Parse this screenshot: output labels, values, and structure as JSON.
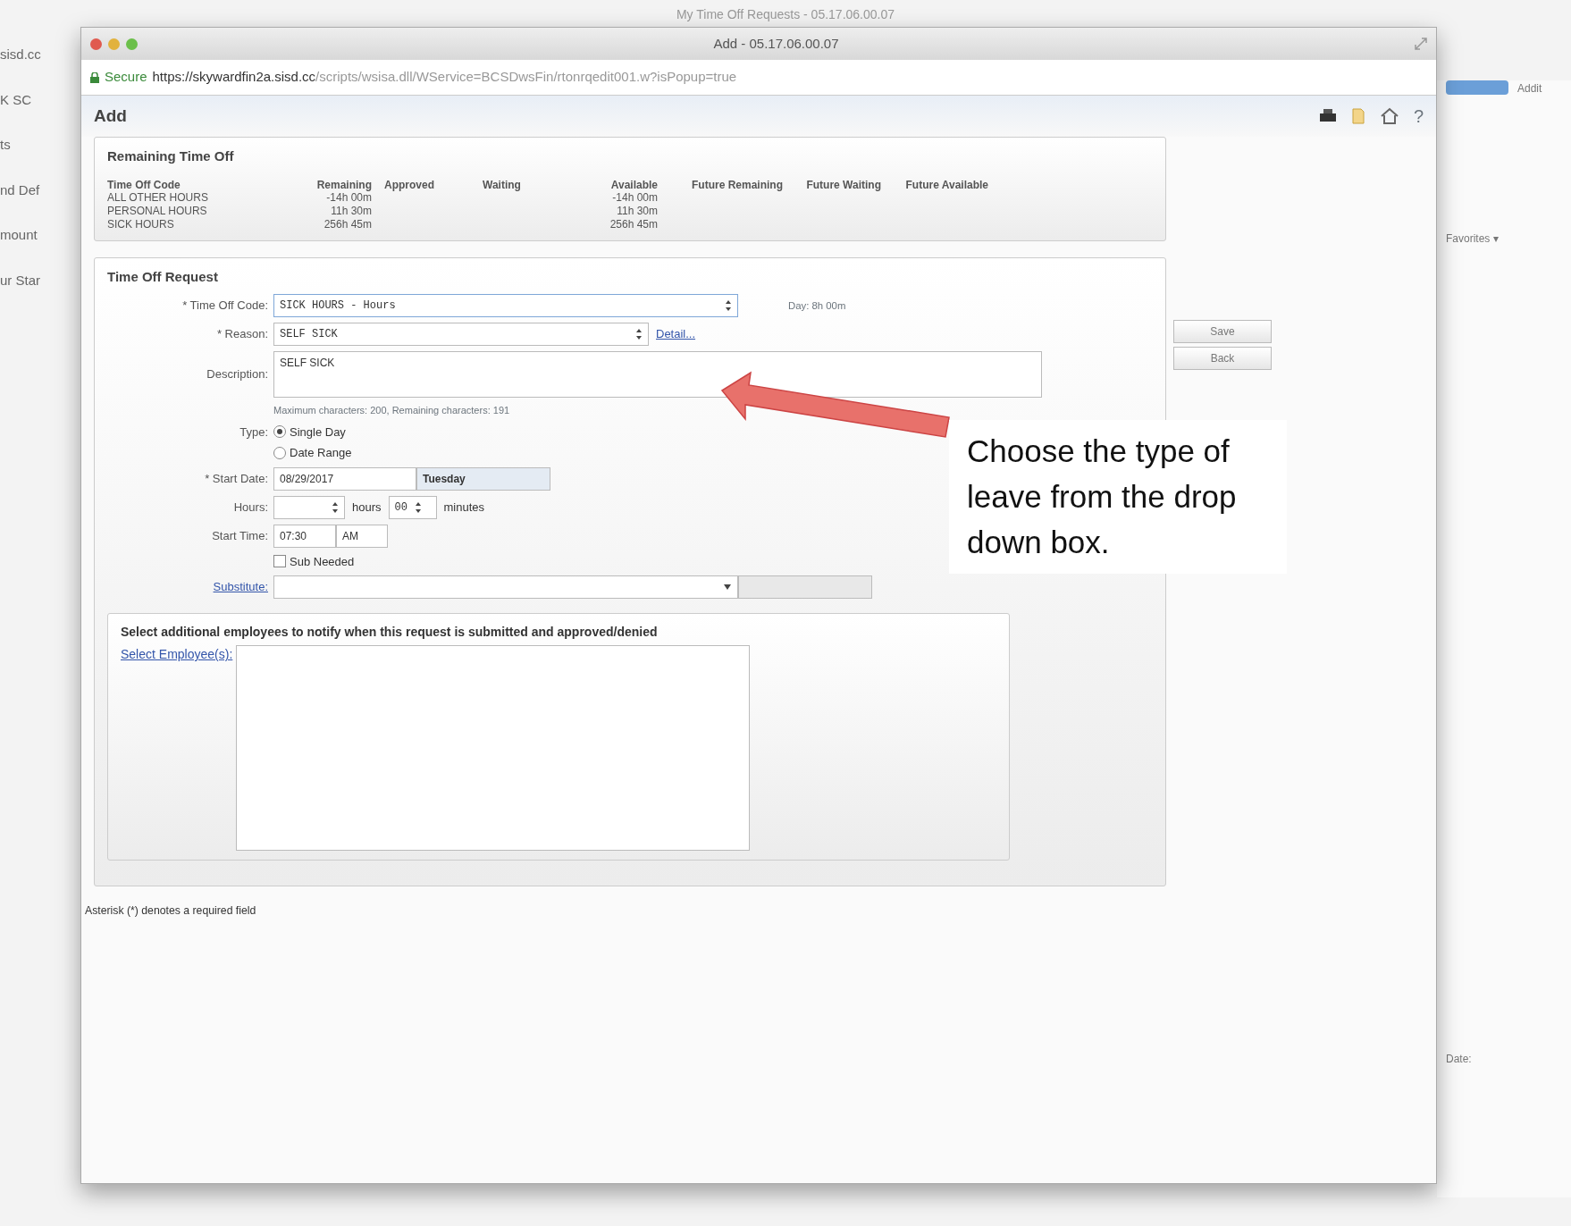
{
  "background_page": {
    "title": "My Time Off Requests - 05.17.06.00.07",
    "left_texts": [
      "sisd.cc",
      "K SC",
      "ts",
      "nd Def",
      "mount",
      "ur Star"
    ],
    "right_texts": [
      "Addit",
      "Favorites ▾",
      "Date:"
    ]
  },
  "window": {
    "title": "Add - 05.17.06.00.07",
    "secure": "Secure",
    "url_host": "https://skywardfin2a.sisd.cc",
    "url_path": "/scripts/wsisa.dll/WService=BCSDwsFin/rtonrqedit001.w?isPopup=true"
  },
  "page_title": "Add",
  "help": "?",
  "remaining": {
    "title": "Remaining Time Off",
    "columns": [
      "Time Off Code",
      "Remaining",
      "Approved",
      "Waiting",
      "Available",
      "Future Remaining",
      "Future Waiting",
      "Future Available"
    ],
    "rows": [
      [
        "ALL OTHER HOURS",
        "-14h 00m",
        "",
        "",
        "-14h 00m",
        "",
        "",
        ""
      ],
      [
        "PERSONAL HOURS",
        "11h 30m",
        "",
        "",
        "11h 30m",
        "",
        "",
        ""
      ],
      [
        "SICK HOURS",
        "256h 45m",
        "",
        "",
        "256h 45m",
        "",
        "",
        ""
      ]
    ]
  },
  "request": {
    "title": "Time Off Request",
    "code": {
      "label": "* Time Off Code:",
      "value": "SICK HOURS - Hours",
      "note": "Day: 8h 00m"
    },
    "reason": {
      "label": "* Reason:",
      "value": "SELF SICK",
      "link": "Detail..."
    },
    "description": {
      "label": "Description:",
      "value": "SELF SICK",
      "hint": "Maximum characters: 200, Remaining characters: 191"
    },
    "type": {
      "label": "Type:",
      "options": [
        {
          "label": "Single Day",
          "selected": true
        },
        {
          "label": "Date Range",
          "selected": false
        }
      ]
    },
    "start_date": {
      "label": "* Start Date:",
      "value": "08/29/2017",
      "day": "Tuesday"
    },
    "hours": {
      "label": "Hours:",
      "unit": "hours",
      "minutes": "00",
      "minutes_unit": "minutes"
    },
    "start_time": {
      "label": "Start Time:",
      "value": "07:30",
      "ampm": "AM"
    },
    "sub_needed": {
      "label": "Sub Needed",
      "checked": false
    },
    "substitute": {
      "link": "Substitute:"
    },
    "notify": {
      "title": "Select additional employees to notify when this request is submitted and approved/denied",
      "link": "Select Employee(s):"
    }
  },
  "buttons": [
    "Save",
    "Back"
  ],
  "footer": "Asterisk (*) denotes a required field",
  "annotation": "Choose the type of leave from the drop down box."
}
